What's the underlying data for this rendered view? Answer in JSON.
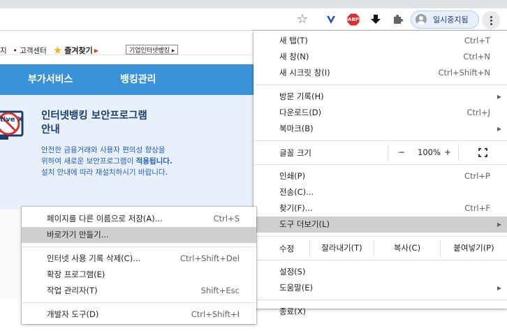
{
  "toolbar": {
    "star_glyph": "☆",
    "abp_label": "ABP",
    "profile_label": "일시중지됨"
  },
  "page": {
    "util_links": [
      "지",
      "• 고객센터"
    ],
    "favorites_label": "즐겨찾기",
    "corp_banking_label": "기업인터넷뱅킹 ▸",
    "nav": [
      "부가서비스",
      "뱅킹관리"
    ],
    "activex_label": "tive X",
    "section_title_line1": "인터넷뱅킹 보안프로그램",
    "section_title_line2": "안내",
    "section_body_line1": "안전한 금융거래와 사용자 편의성 향상을",
    "section_body_line2_a": "위하여 새로운 보안프로그램이 ",
    "section_body_line2_b": "적용됩니다.",
    "section_body_line3": "설치 안내에 따라 재설치하시기 바랍니다."
  },
  "main_menu": {
    "new_tab": {
      "label": "새 탭(T)",
      "shortcut": "Ctrl+T"
    },
    "new_window": {
      "label": "새 창(N)",
      "shortcut": "Ctrl+N"
    },
    "incognito": {
      "label": "새 시크릿 창(I)",
      "shortcut": "Ctrl+Shift+N"
    },
    "history": {
      "label": "방문 기록(H)"
    },
    "downloads": {
      "label": "다운로드(D)",
      "shortcut": "Ctrl+J"
    },
    "bookmarks": {
      "label": "북마크(B)"
    },
    "zoom": {
      "label": "글꼴 크기",
      "minus": "−",
      "value": "100%",
      "plus": "+"
    },
    "print": {
      "label": "인쇄(P)",
      "shortcut": "Ctrl+P"
    },
    "cast": {
      "label": "전송(C)..."
    },
    "find": {
      "label": "찾기(F)...",
      "shortcut": "Ctrl+F"
    },
    "more_tools": {
      "label": "도구 더보기(L)"
    },
    "edit": {
      "label": "수정",
      "cut": "잘라내기(T)",
      "copy": "복사(C)",
      "paste": "붙여넣기(P)"
    },
    "settings": {
      "label": "설정(S)"
    },
    "help": {
      "label": "도움말(E)"
    },
    "exit": {
      "label": "종료(X)"
    }
  },
  "sub_menu": {
    "save_page": {
      "label": "페이지를 다른 이름으로 저장(A)...",
      "shortcut": "Ctrl+S"
    },
    "create_shortcut": {
      "label": "바로가기 만들기..."
    },
    "clear_data": {
      "label": "인터넷 사용 기록 삭제(C)...",
      "shortcut": "Ctrl+Shift+Del"
    },
    "extensions": {
      "label": "확장 프로그램(E)"
    },
    "task_manager": {
      "label": "작업 관리자(T)",
      "shortcut": "Shift+Esc"
    },
    "dev_tools": {
      "label": "개발자 도구(D)",
      "shortcut": "Ctrl+Shift+I"
    }
  },
  "colors": {
    "nav_blue": "#3a93d9",
    "highlight": "#cfcfcf",
    "abp_red": "#d6312b"
  }
}
